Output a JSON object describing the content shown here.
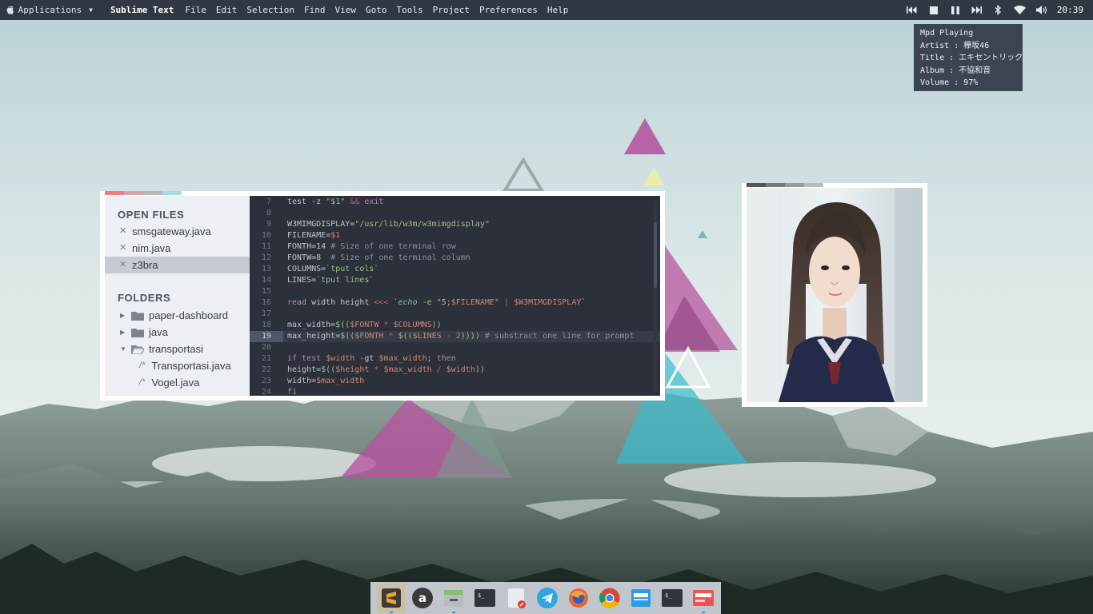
{
  "top_panel": {
    "applications_label": "Applications",
    "app_name": "Sublime Text",
    "menu": [
      "File",
      "Edit",
      "Selection",
      "Find",
      "View",
      "Goto",
      "Tools",
      "Project",
      "Preferences",
      "Help"
    ],
    "clock": "20:39",
    "icons": [
      "previous-track-icon",
      "stop-icon",
      "pause-icon",
      "next-track-icon",
      "bluetooth-icon",
      "wifi-icon",
      "volume-icon"
    ]
  },
  "mpd": {
    "title": "Mpd Playing",
    "artist": "Artist : 欅坂46",
    "track": "Title : エキセントリック",
    "album": "Album : 不協和音",
    "volume": "Volume : 97%"
  },
  "sidebar": {
    "open_files_heading": "OPEN FILES",
    "open_files": [
      "smsgateway.java",
      "nim.java",
      "z3bra"
    ],
    "active_file": "z3bra",
    "folders_heading": "FOLDERS",
    "folders": [
      "paper-dashboard",
      "java",
      "transportasi"
    ],
    "subfiles": [
      "Transportasi.java",
      "Vogel.java"
    ],
    "subfile_marker": "/*"
  },
  "editor": {
    "line_numbers": [
      "7",
      "8",
      "9",
      "10",
      "11",
      "12",
      "13",
      "14",
      "15",
      "16",
      "17",
      "18",
      "19",
      "20",
      "21",
      "22",
      "23",
      "24"
    ],
    "highlighted_line": "19"
  },
  "colors": {
    "panel": "#313843",
    "editor_bg": "#2b303b",
    "sidebar_bg": "#eceff3",
    "tab_colors": [
      "#ef7b7b",
      "#d4a7a7",
      "#b8b8b8",
      "#a6dbe0"
    ],
    "photo_tab_colors": [
      "#555555",
      "#777777",
      "#999999",
      "#bbbbbb"
    ]
  },
  "dock": {
    "items": [
      "sublime-text-icon",
      "amazon-icon",
      "file-manager-icon",
      "terminal-icon",
      "text-editor-icon",
      "telegram-icon",
      "firefox-icon",
      "chrome-icon",
      "archive-manager-icon",
      "terminal-icon-2",
      "screenshot-icon"
    ]
  }
}
